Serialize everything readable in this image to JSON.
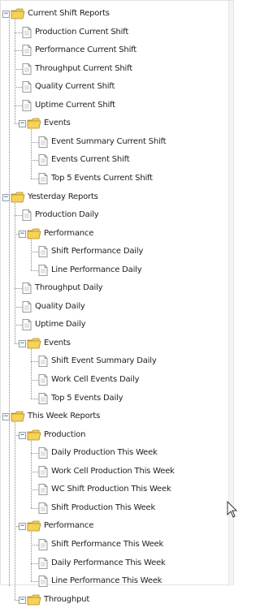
{
  "tree": [
    {
      "label": "Current Shift Reports",
      "type": "folder",
      "expanded": true,
      "children": [
        {
          "label": "Production Current Shift",
          "type": "report"
        },
        {
          "label": "Performance Current Shift",
          "type": "report"
        },
        {
          "label": "Throughput Current Shift",
          "type": "report"
        },
        {
          "label": "Quality Current Shift",
          "type": "report"
        },
        {
          "label": "Uptime Current Shift",
          "type": "report"
        },
        {
          "label": "Events",
          "type": "folder",
          "expanded": true,
          "children": [
            {
              "label": "Event Summary Current Shift",
              "type": "report"
            },
            {
              "label": "Events Current Shift",
              "type": "report"
            },
            {
              "label": "Top 5 Events Current Shift",
              "type": "report"
            }
          ]
        }
      ]
    },
    {
      "label": "Yesterday Reports",
      "type": "folder",
      "expanded": true,
      "children": [
        {
          "label": "Production Daily",
          "type": "report"
        },
        {
          "label": "Performance",
          "type": "folder",
          "expanded": true,
          "children": [
            {
              "label": "Shift Performance Daily",
              "type": "report"
            },
            {
              "label": "Line Performance Daily",
              "type": "report"
            }
          ]
        },
        {
          "label": "Throughput Daily",
          "type": "report"
        },
        {
          "label": "Quality Daily",
          "type": "report"
        },
        {
          "label": "Uptime Daily",
          "type": "report"
        },
        {
          "label": "Events",
          "type": "folder",
          "expanded": true,
          "children": [
            {
              "label": "Shift Event Summary Daily",
              "type": "report"
            },
            {
              "label": "Work Cell Events Daily",
              "type": "report"
            },
            {
              "label": "Top 5 Events Daily",
              "type": "report"
            }
          ]
        }
      ]
    },
    {
      "label": "This Week Reports",
      "type": "folder",
      "expanded": true,
      "children": [
        {
          "label": "Production",
          "type": "folder",
          "expanded": true,
          "children": [
            {
              "label": "Daily Production This Week",
              "type": "report"
            },
            {
              "label": "Work Cell Production This Week",
              "type": "report"
            },
            {
              "label": "WC Shift Production This Week",
              "type": "report"
            },
            {
              "label": "Shift Production This Week",
              "type": "report"
            }
          ]
        },
        {
          "label": "Performance",
          "type": "folder",
          "expanded": true,
          "children": [
            {
              "label": "Shift Performance This Week",
              "type": "report"
            },
            {
              "label": "Daily Performance This Week",
              "type": "report"
            },
            {
              "label": "Line Performance This Week",
              "type": "report"
            }
          ]
        },
        {
          "label": "Throughput",
          "type": "folder",
          "expanded": true,
          "children": []
        }
      ]
    }
  ],
  "icons": {
    "folder": "folder-icon",
    "report": "document-icon",
    "expander": "minus-expander-icon",
    "cursor": "mouse-pointer-icon"
  },
  "colors": {
    "folder_fill": "#f6d25a",
    "folder_stroke": "#b08a1e",
    "document_fill": "#ffffff",
    "document_stroke": "#7a7a7a",
    "connector": "#8a8a8a",
    "expander_border": "#8f9db0"
  }
}
